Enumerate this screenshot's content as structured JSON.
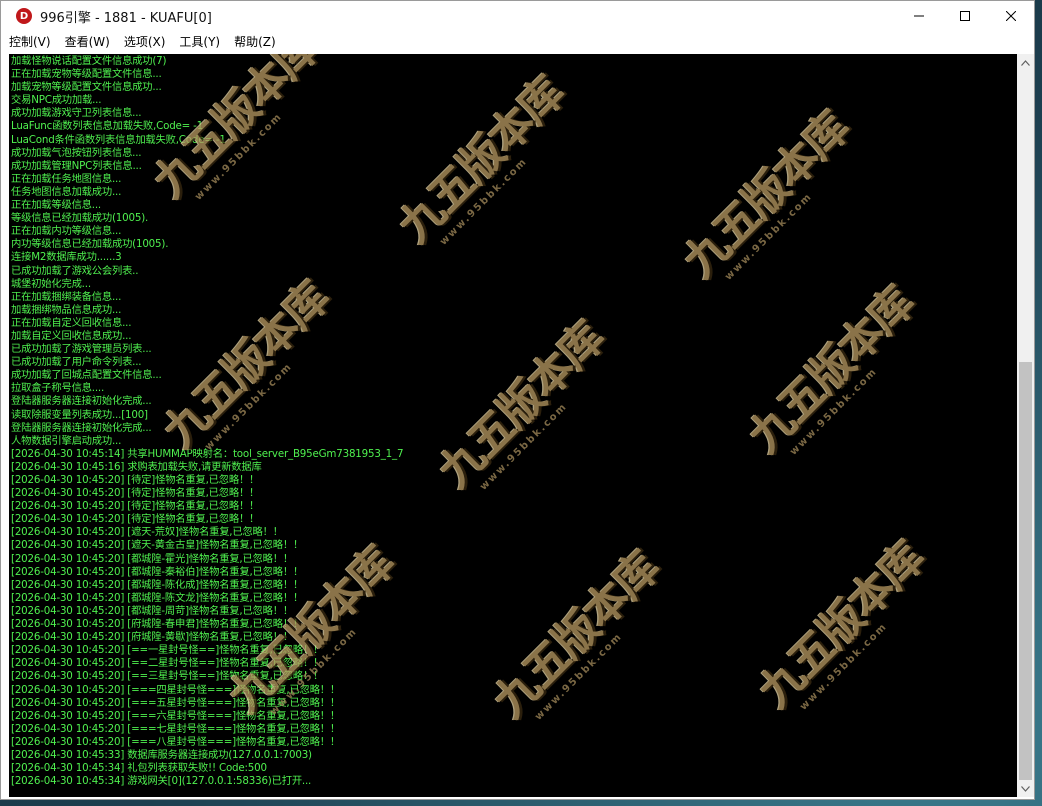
{
  "window": {
    "title": "996引擎 - 1881 - KUAFU[0]",
    "icon_letter": "D",
    "icon_color": "#c0181b"
  },
  "menu": [
    "控制(V)",
    "查看(W)",
    "选项(X)",
    "工具(Y)",
    "帮助(Z)"
  ],
  "console": {
    "text_color": "#4ff04f",
    "background": "#000000",
    "lines": [
      "加载怪物说话配置文件信息成功(7)",
      "正在加载宠物等级配置文件信息...",
      "加载宠物等级配置文件信息成功...",
      "交易NPC成功加载...",
      "成功加载游戏守卫列表信息...",
      "LuaFunc函数列表信息加载失败,Code= -1",
      "LuaCond条件函数列表信息加载失败,Code= -1",
      "成功加载气泡按钮列表信息...",
      "成功加载管理NPC列表信息...",
      "正在加载任务地图信息...",
      "任务地图信息加载成功...",
      "正在加载等级信息...",
      "等级信息已经加载成功(1005).",
      "正在加载内功等级信息...",
      "内功等级信息已经加载成功(1005).",
      "连接M2数据库成功......3",
      "已成功加载了游戏公会列表..",
      "城堡初始化完成...",
      "正在加载捆绑装备信息...",
      "加载捆绑物品信息成功...",
      "正在加载自定义回收信息...",
      "加载自定义回收信息成功...",
      "已成功加载了游戏管理员列表...",
      "已成功加载了用户命令列表...",
      "成功加载了回城点配置文件信息...",
      "拉取盒子称号信息....",
      "登陆器服务器连接初始化完成...",
      "读取除服变量列表成功...[100]",
      "登陆器服务器连接初始化完成...",
      "人物数据引擎启动成功...",
      "[2026-04-30 10:45:14] 共享HUMMAP映射名：tool_server_B95eGm7381953_1_7",
      "[2026-04-30 10:45:16] 求购表加载失败,请更新数据库",
      "[2026-04-30 10:45:20] [待定]怪物名重复,已忽略！！",
      "[2026-04-30 10:45:20] [待定]怪物名重复,已忽略！！",
      "[2026-04-30 10:45:20] [待定]怪物名重复,已忽略！！",
      "[2026-04-30 10:45:20] [待定]怪物名重复,已忽略！！",
      "[2026-04-30 10:45:20] [遮天-荒奴]怪物名重复,已忽略！！",
      "[2026-04-30 10:45:20] [遮天-黄金古皇]怪物名重复,已忽略！！",
      "[2026-04-30 10:45:20] [都城隍-霍光]怪物名重复,已忽略！！",
      "[2026-04-30 10:45:20] [都城隍-秦裕伯]怪物名重复,已忽略！！",
      "[2026-04-30 10:45:20] [都城隍-陈化成]怪物名重复,已忽略！！",
      "[2026-04-30 10:45:20] [都城隍-陈文龙]怪物名重复,已忽略！！",
      "[2026-04-30 10:45:20] [都城隍-周苛]怪物名重复,已忽略！！",
      "[2026-04-30 10:45:20] [府城隍-春申君]怪物名重复,已忽略！！",
      "[2026-04-30 10:45:20] [府城隍-黄歇]怪物名重复,已忽略！！",
      "[2026-04-30 10:45:20] [==一星封号怪==]怪物名重复,已忽略！！",
      "[2026-04-30 10:45:20] [==二星封号怪==]怪物名重复,已忽略！！",
      "[2026-04-30 10:45:20] [==三星封号怪==]怪物名重复,已忽略！！",
      "[2026-04-30 10:45:20] [===四星封号怪===]怪物名重复,已忽略！！",
      "[2026-04-30 10:45:20] [===五星封号怪===]怪物名重复,已忽略！！",
      "[2026-04-30 10:45:20] [===六星封号怪===]怪物名重复,已忽略！！",
      "[2026-04-30 10:45:20] [===七星封号怪===]怪物名重复,已忽略！！",
      "[2026-04-30 10:45:20] [===八星封号怪===]怪物名重复,已忽略！！",
      "[2026-04-30 10:45:33] 数据库服务器连接成功(127.0.0.1:7003)",
      "[2026-04-30 10:45:34] 礼包列表获取失败!! Code:500",
      "[2026-04-30 10:45:34] 游戏网关[0](127.0.0.1:58336)已打开..."
    ]
  },
  "watermark": {
    "text": "九五版本库",
    "url": "www.95bbk.com"
  },
  "scrollbar": {
    "scroll_position_fraction": 0.41,
    "visible_fraction": 0.59
  }
}
